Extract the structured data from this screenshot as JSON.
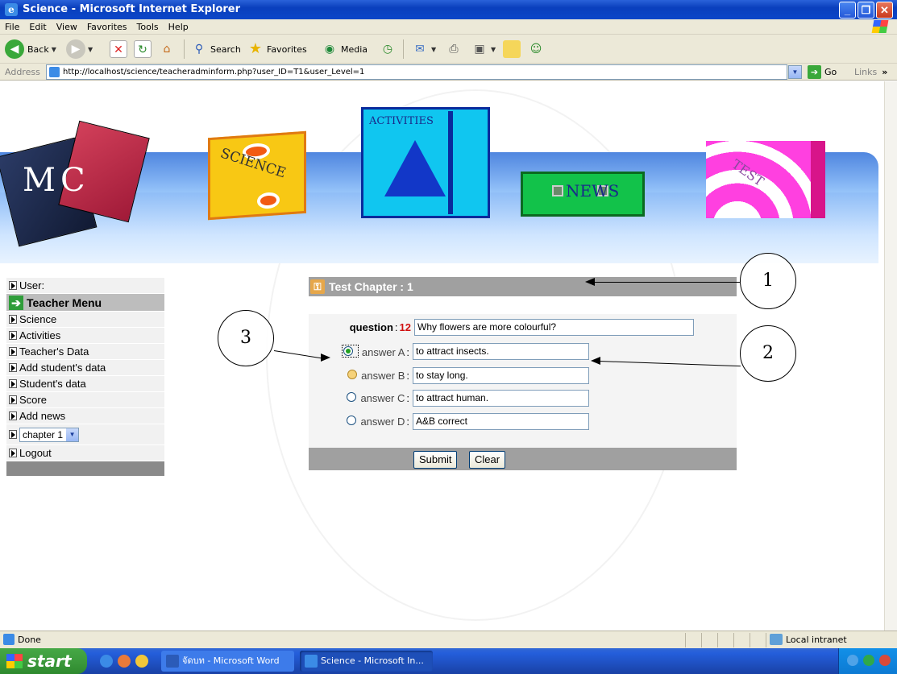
{
  "window": {
    "title": "Science - Microsoft Internet Explorer",
    "controls": {
      "minimize": "_",
      "maximize": "❐",
      "close": "✕"
    }
  },
  "menu": [
    "File",
    "Edit",
    "View",
    "Favorites",
    "Tools",
    "Help"
  ],
  "toolbar": {
    "back": "Back",
    "search": "Search",
    "favorites": "Favorites",
    "media": "Media"
  },
  "address": {
    "label": "Address",
    "url": "http://localhost/science/teacheradminform.php?user_ID=T1&user_Level=1",
    "go": "Go",
    "links": "Links"
  },
  "banner": {
    "logo": "MC",
    "items": [
      "SCIENCE",
      "ACTIVITIES",
      "NEWS",
      "TEST"
    ]
  },
  "sidebar": {
    "user_label": "User:",
    "header": "Teacher Menu",
    "items": [
      "Science",
      "Activities",
      "Teacher's Data",
      "Add student's data",
      "Student's data",
      "Score",
      "Add news"
    ],
    "chapter_select": "chapter 1",
    "logout": "Logout"
  },
  "test": {
    "title": "Test Chapter : 1",
    "question_label": "question",
    "question_number": "12",
    "question_text": "Why flowers are  more colourful?",
    "answers": [
      {
        "label": "answer A",
        "value": "to attract insects.",
        "checked": true
      },
      {
        "label": "answer B",
        "value": "to stay long.",
        "checked": false
      },
      {
        "label": "answer C",
        "value": "to attract human.",
        "checked": false
      },
      {
        "label": "answer D",
        "value": "A&B correct",
        "checked": false
      }
    ],
    "submit": "Submit",
    "clear": "Clear"
  },
  "callouts": [
    "1",
    "2",
    "3"
  ],
  "status": {
    "text": "Done",
    "zone": "Local intranet"
  },
  "taskbar": {
    "start": "start",
    "tasks": [
      "จัดบท - Microsoft Word",
      "Science - Microsoft In..."
    ]
  }
}
